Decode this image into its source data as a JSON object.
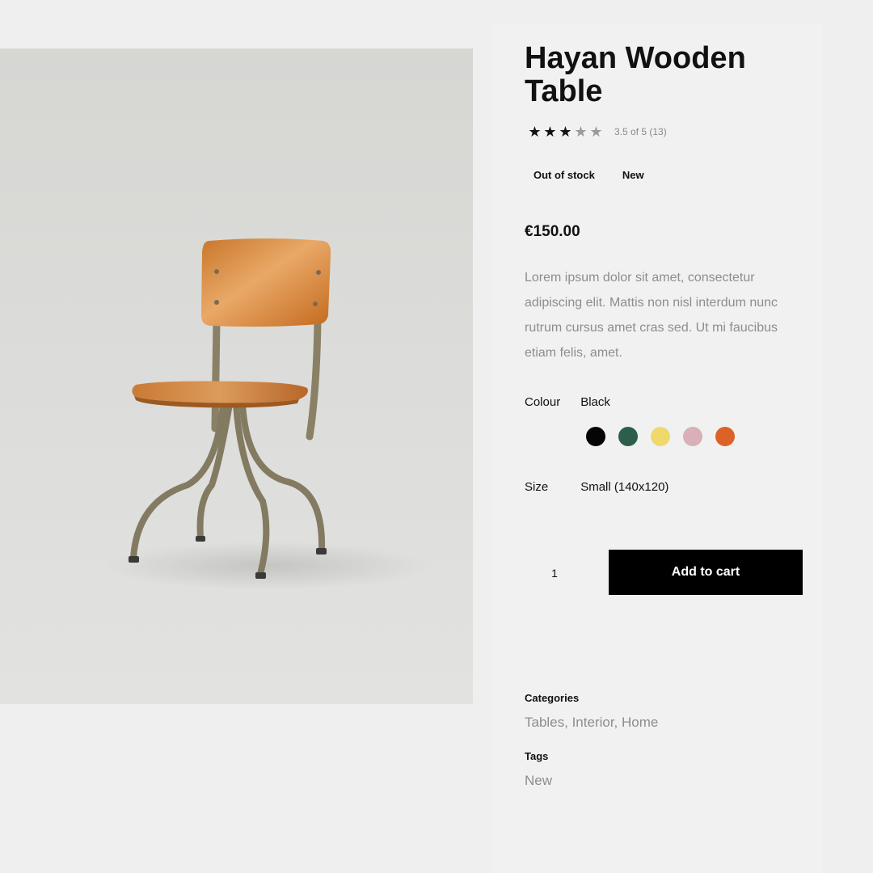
{
  "product": {
    "title": "Hayan Wooden Table",
    "rating": 3.5,
    "rating_max": 5,
    "rating_text": "3.5 of 5 (13)",
    "badges": [
      "Out of stock",
      "New"
    ],
    "price": "€150.00",
    "description": "Lorem ipsum dolor sit amet, consectetur adipiscing elit. Mattis non nisl interdum nunc rutrum cursus amet cras sed. Ut mi faucibus etiam felis, amet."
  },
  "colour": {
    "label": "Colour",
    "selected": "Black",
    "swatches": [
      {
        "name": "black",
        "color": "#050505"
      },
      {
        "name": "green",
        "color": "#2d5e4b"
      },
      {
        "name": "yellow",
        "color": "#f0d96c"
      },
      {
        "name": "pink",
        "color": "#d9b0b7"
      },
      {
        "name": "orange",
        "color": "#dc6227"
      }
    ]
  },
  "size": {
    "label": "Size",
    "selected": "Small (140x120)"
  },
  "cart": {
    "quantity": "1",
    "button_label": "Add to cart"
  },
  "meta": {
    "categories_label": "Categories",
    "categories_value": "Tables, Interior, Home",
    "tags_label": "Tags",
    "tags_value": "New"
  },
  "image": {
    "subject": "wooden chair with metal legs"
  }
}
